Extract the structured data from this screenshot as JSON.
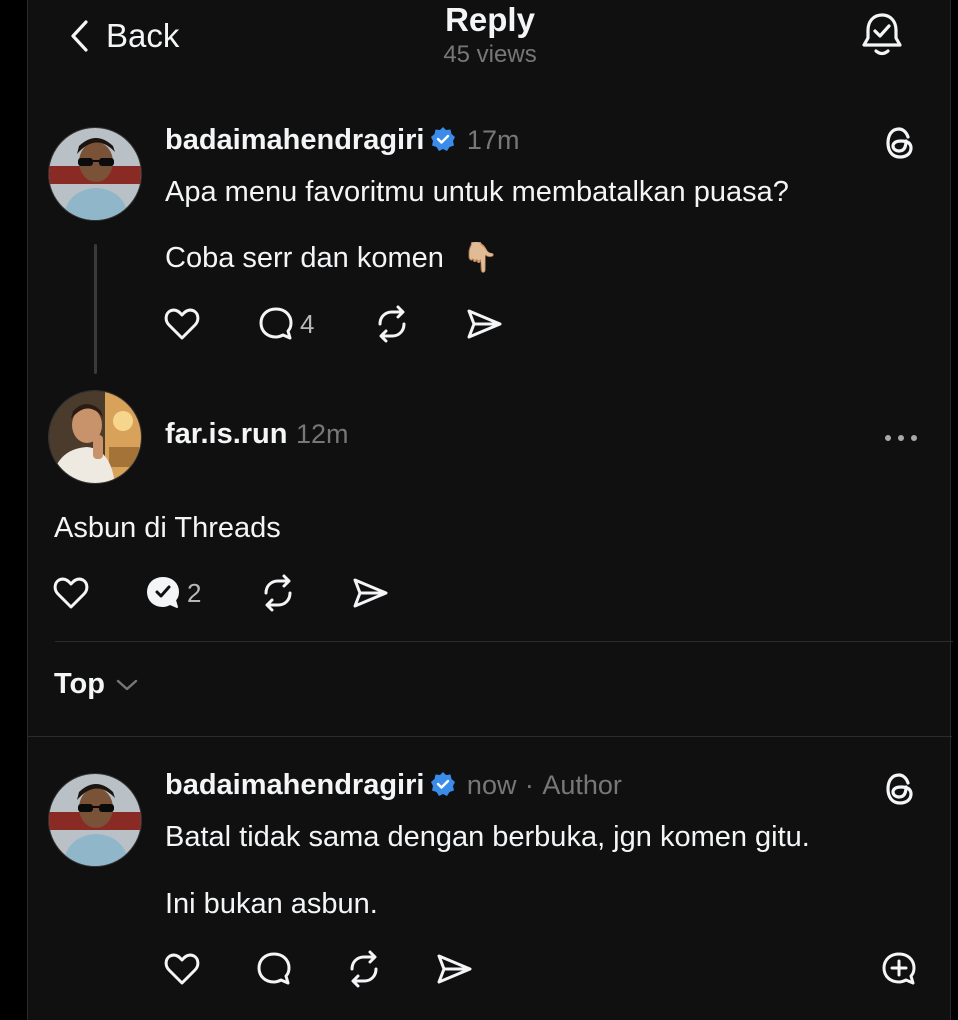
{
  "header": {
    "back_label": "Back",
    "title": "Reply",
    "views": "45 views"
  },
  "original_post": {
    "username": "badaimahendragiri",
    "time": "17m",
    "line1": "Apa menu favoritmu untuk membatalkan puasa?",
    "line2": "Coba serr dan komen",
    "emoji": "👇🏼",
    "reply_count": "4"
  },
  "reply_post": {
    "username": "far.is.run",
    "time": "12m",
    "text": "Asbun di Threads",
    "reply_count": "2"
  },
  "sort": {
    "label": "Top"
  },
  "author_reply": {
    "username": "badaimahendragiri",
    "time": "now",
    "separator": "·",
    "badge": "Author",
    "line1": "Batal tidak sama dengan berbuka, jgn komen gitu.",
    "line2": "Ini bukan asbun."
  },
  "colors": {
    "background": "#101010",
    "text": "#f3f5f7",
    "muted": "#777777",
    "verified": "#0095f6"
  },
  "icons": [
    "chevron-left-icon",
    "bell-check-icon",
    "threads-logo-icon",
    "verified-badge-icon",
    "heart-icon",
    "comment-icon",
    "repost-icon",
    "share-icon",
    "more-icon",
    "chevron-down-icon",
    "quote-add-icon"
  ]
}
